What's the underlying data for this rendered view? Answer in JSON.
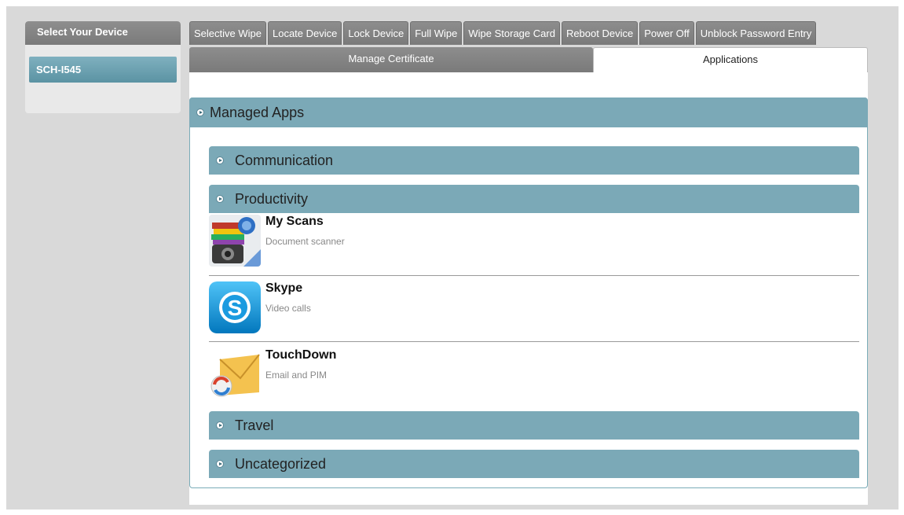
{
  "device_panel": {
    "header": "Select Your Device",
    "devices": [
      "SCH-I545"
    ]
  },
  "tabs": {
    "row1": [
      "Selective Wipe",
      "Locate Device",
      "Lock Device",
      "Full Wipe",
      "Wipe Storage Card",
      "Reboot Device",
      "Power Off",
      "Unblock Password Entry"
    ],
    "row2": [
      "Manage Certificate",
      "Applications"
    ],
    "active": "Applications"
  },
  "managed_apps": {
    "title": "Managed Apps",
    "categories": [
      "Communication",
      "Productivity",
      "Travel",
      "Uncategorized"
    ],
    "expanded": "Productivity",
    "apps": [
      {
        "name": "My Scans",
        "description": "Document scanner",
        "icon": "my-scans-icon"
      },
      {
        "name": "Skype",
        "description": "Video calls",
        "icon": "skype-icon"
      },
      {
        "name": "TouchDown",
        "description": "Email and PIM",
        "icon": "touchdown-icon"
      }
    ]
  },
  "colors": {
    "accent_bar": "#7ba9b7",
    "device_selected": "#6fa3b3",
    "tab_gray": "#8a8a8a"
  }
}
